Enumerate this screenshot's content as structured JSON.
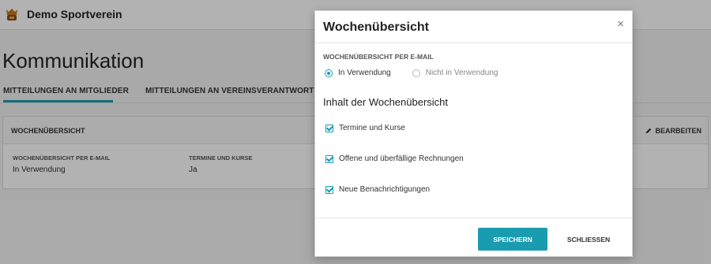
{
  "header": {
    "club_name": "Demo Sportverein",
    "logo_icon": "club-crest-icon"
  },
  "page": {
    "title": "Kommunikation"
  },
  "tabs": [
    {
      "label": "MITTEILUNGEN AN MITGLIEDER",
      "active": true
    },
    {
      "label": "MITTEILUNGEN AN VEREINSVERANTWORTLICHE",
      "active": false
    }
  ],
  "card": {
    "title": "WOCHENÜBERSICHT",
    "edit_label": "BEARBEITEN",
    "edit_icon": "pencil-icon",
    "fields": [
      {
        "label": "WOCHENÜBERSICHT PER E-MAIL",
        "value": "In Verwendung"
      },
      {
        "label": "TERMINE UND KURSE",
        "value": "Ja"
      }
    ]
  },
  "modal": {
    "title": "Wochenübersicht",
    "close_symbol": "×",
    "section_label": "WOCHENÜBERSICHT PER E-MAIL",
    "radio_options": [
      {
        "label": "In Verwendung",
        "checked": true
      },
      {
        "label": "Nicht in Verwendung",
        "checked": false
      }
    ],
    "content_heading": "Inhalt der Wochenübersicht",
    "checkboxes": [
      {
        "label": "Termine und Kurse",
        "checked": true
      },
      {
        "label": "Offene und überfällige Rechnungen",
        "checked": true
      },
      {
        "label": "Neue Benachrichtigungen",
        "checked": true
      }
    ],
    "save_label": "SPEICHERN",
    "close_label": "SCHLIESSEN"
  },
  "colors": {
    "accent": "#1a9cb0"
  }
}
